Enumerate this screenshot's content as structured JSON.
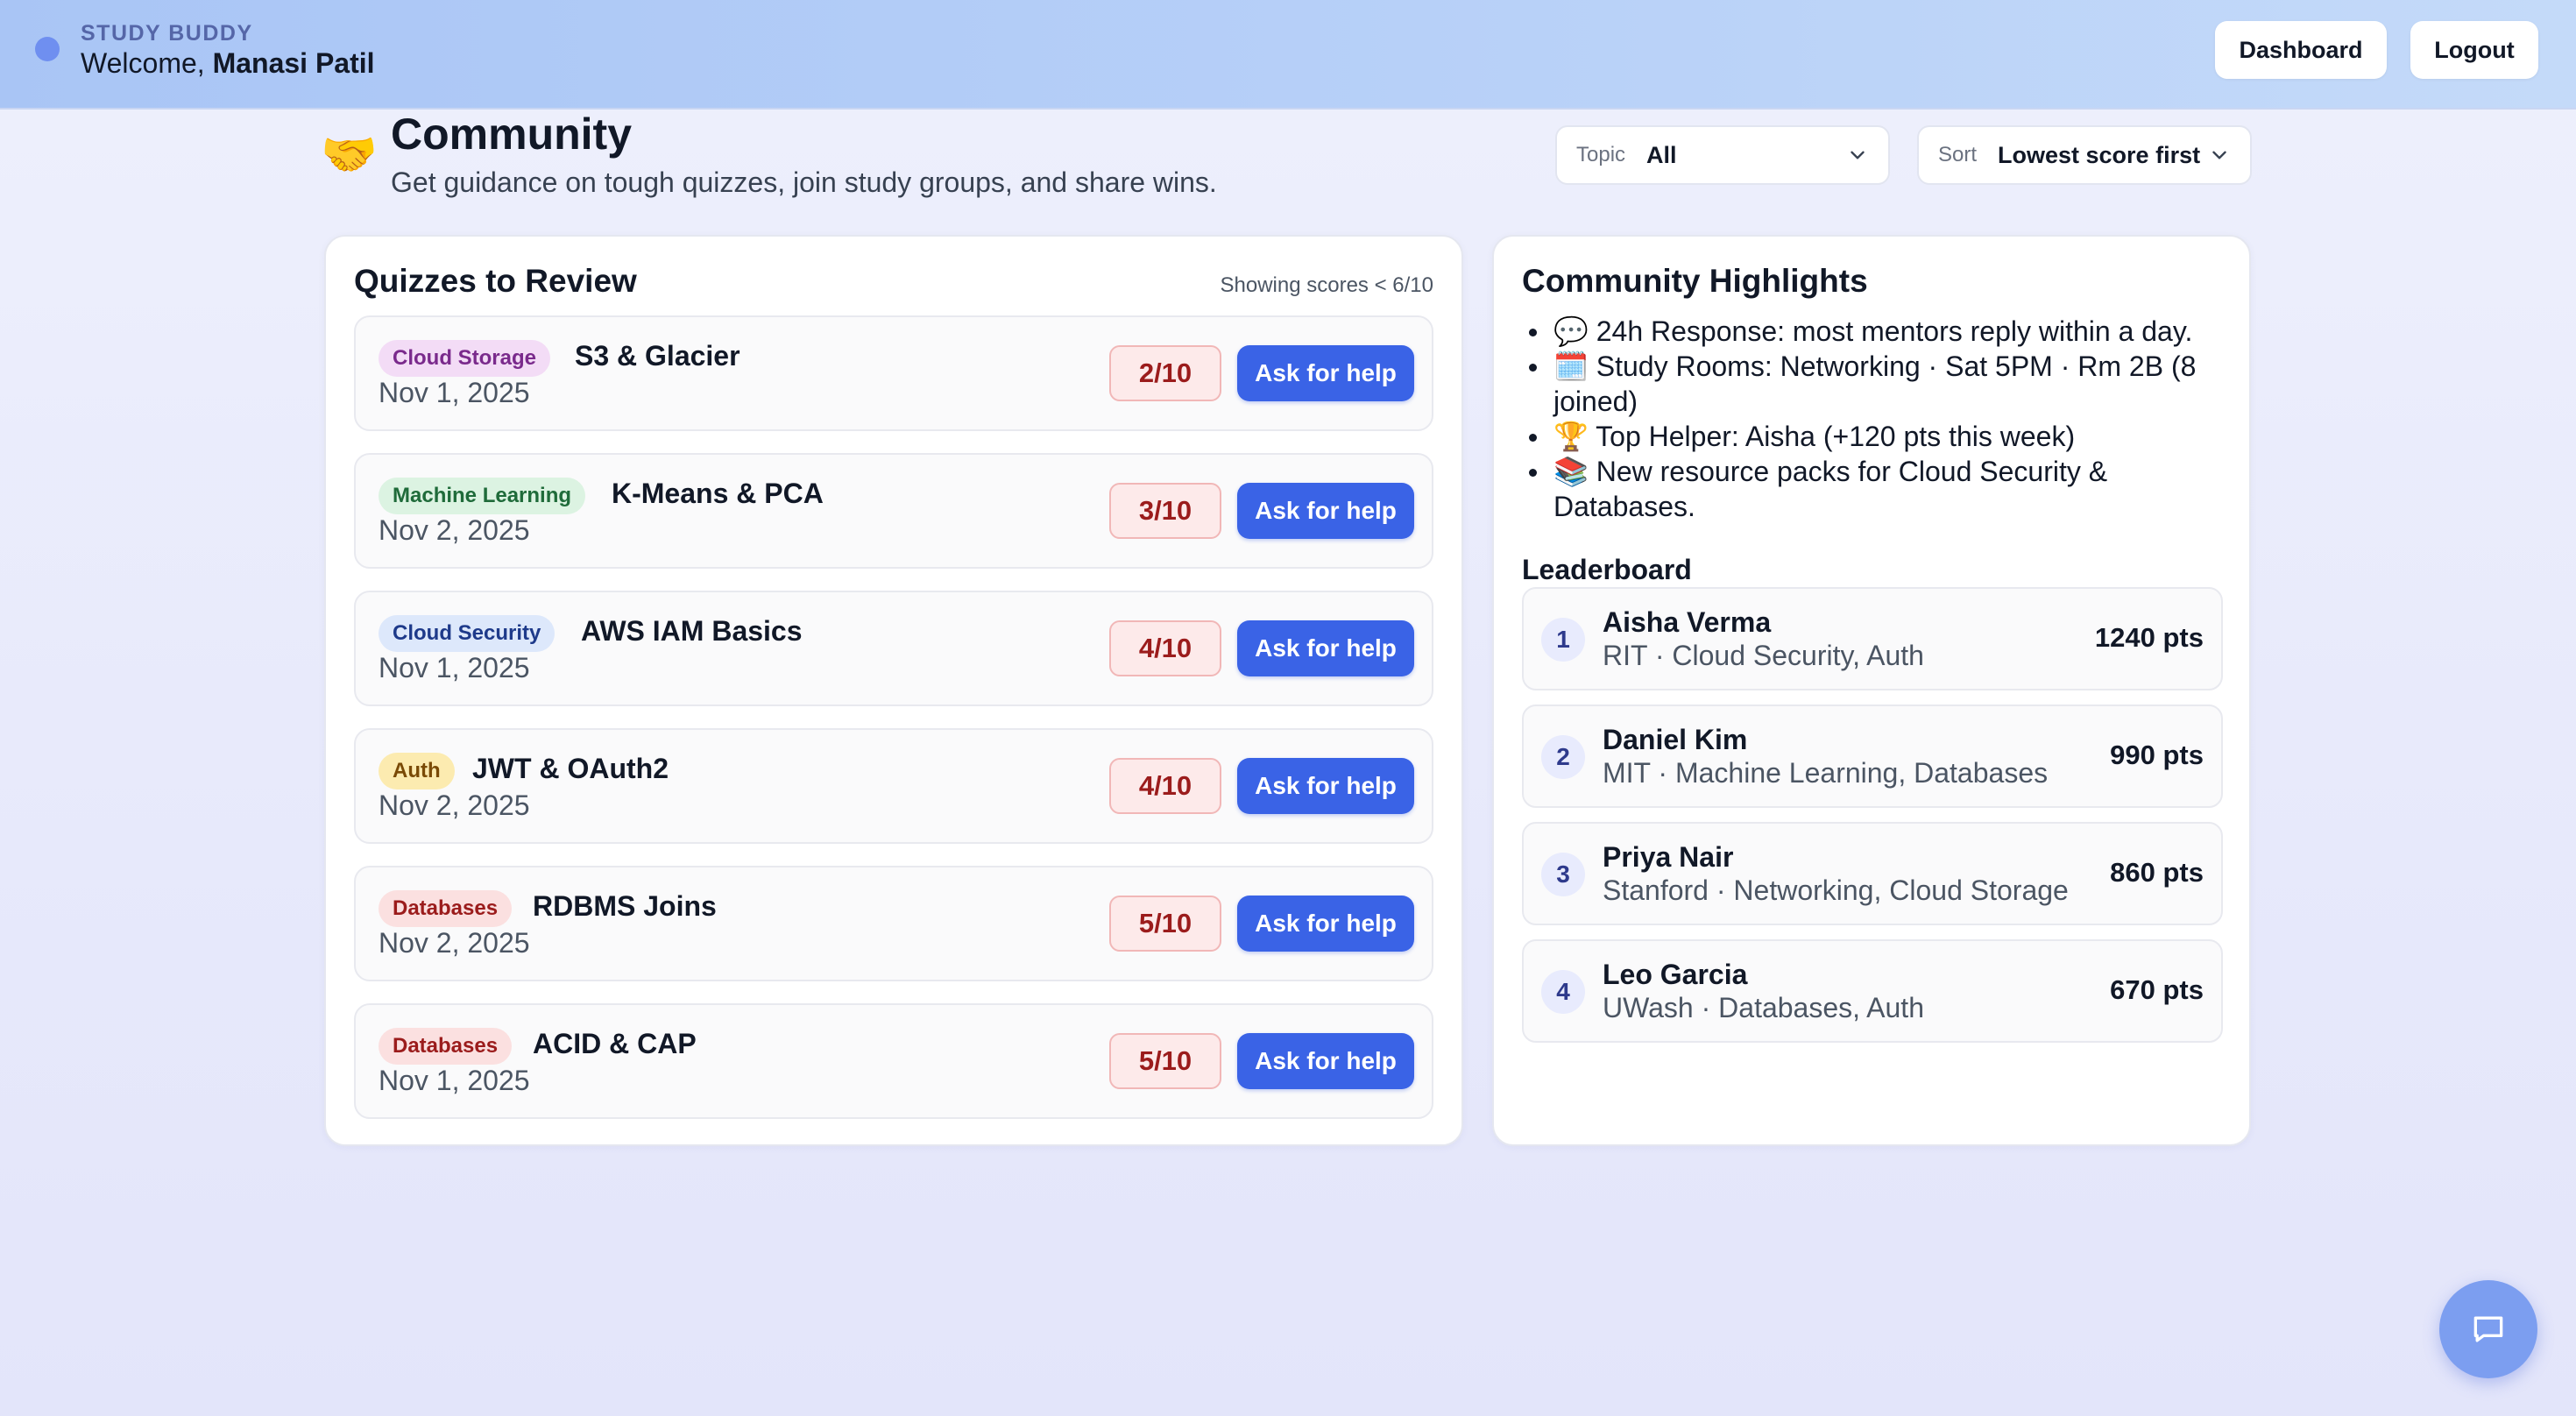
{
  "header": {
    "brand": "STUDY BUDDY",
    "welcome_prefix": "Welcome,",
    "user_name": "Manasi Patil",
    "nav": {
      "dashboard": "Dashboard",
      "logout": "Logout"
    }
  },
  "page": {
    "icon": "🤝",
    "title": "Community",
    "subtitle": "Get guidance on tough quizzes, join study groups, and share wins."
  },
  "filters": {
    "topic": {
      "label": "Topic",
      "value": "All"
    },
    "sort": {
      "label": "Sort",
      "value": "Lowest score first"
    }
  },
  "quizzes": {
    "title": "Quizzes to Review",
    "showing": "Showing scores < 6/10",
    "help_label": "Ask for help",
    "items": [
      {
        "tag": "Cloud Storage",
        "tag_bg": "#f3dcf6",
        "tag_fg": "#7a2a8c",
        "title": "S3 & Glacier",
        "date": "Nov 1, 2025",
        "score": "2/10"
      },
      {
        "tag": "Machine Learning",
        "tag_bg": "#dcf3e2",
        "tag_fg": "#1f6b3a",
        "title": "K-Means & PCA",
        "date": "Nov 2, 2025",
        "score": "3/10"
      },
      {
        "tag": "Cloud Security",
        "tag_bg": "#dde8fb",
        "tag_fg": "#1e3a8a",
        "title": "AWS IAM Basics",
        "date": "Nov 1, 2025",
        "score": "4/10"
      },
      {
        "tag": "Auth",
        "tag_bg": "#fcebb0",
        "tag_fg": "#7a4a06",
        "title": "JWT & OAuth2",
        "date": "Nov 2, 2025",
        "score": "4/10"
      },
      {
        "tag": "Databases",
        "tag_bg": "#fbe0e0",
        "tag_fg": "#9b1c1c",
        "title": "RDBMS Joins",
        "date": "Nov 2, 2025",
        "score": "5/10"
      },
      {
        "tag": "Databases",
        "tag_bg": "#fbe0e0",
        "tag_fg": "#9b1c1c",
        "title": "ACID & CAP",
        "date": "Nov 1, 2025",
        "score": "5/10"
      }
    ]
  },
  "highlights": {
    "title": "Community Highlights",
    "items": [
      "💬 24h Response: most mentors reply within a day.",
      "🗓️ Study Rooms: Networking · Sat 5PM · Rm 2B (8 joined)",
      "🏆 Top Helper: Aisha (+120 pts this week)",
      "📚 New resource packs for Cloud Security & Databases."
    ]
  },
  "leaderboard": {
    "title": "Leaderboard",
    "rows": [
      {
        "rank": "1",
        "name": "Aisha Verma",
        "meta": "RIT · Cloud Security, Auth",
        "points": "1240 pts"
      },
      {
        "rank": "2",
        "name": "Daniel Kim",
        "meta": "MIT · Machine Learning, Databases",
        "points": "990 pts"
      },
      {
        "rank": "3",
        "name": "Priya Nair",
        "meta": "Stanford · Networking, Cloud Storage",
        "points": "860 pts"
      },
      {
        "rank": "4",
        "name": "Leo Garcia",
        "meta": "UWash · Databases, Auth",
        "points": "670 pts"
      }
    ]
  },
  "icons": {
    "brand": "brand-dot-icon",
    "page": "handshake-icon",
    "dropdown": "chevron-down-icon",
    "chat": "chat-bubble-icon"
  },
  "colors": {
    "accent": "#3a63e6",
    "score_bg": "#fdeaea",
    "score_text": "#9b1c1c",
    "chat_fab": "#7c9ef0"
  }
}
